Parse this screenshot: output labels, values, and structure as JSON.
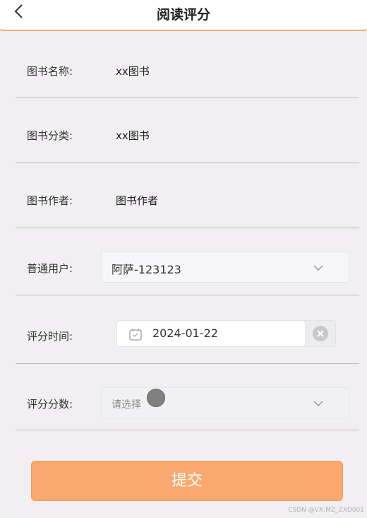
{
  "header": {
    "title": "阅读评分",
    "back_icon": "chevron-left-icon"
  },
  "form": {
    "book_name": {
      "label": "图书名称:",
      "value": "xx图书"
    },
    "book_category": {
      "label": "图书分类:",
      "value": "xx图书"
    },
    "book_author": {
      "label": "图书作者:",
      "value": "图书作者"
    },
    "user": {
      "label": "普通用户:",
      "value": "阿萨-123123",
      "icon": "chevron-down-icon"
    },
    "rating_time": {
      "label": "评分时间:",
      "value": "2024-01-22",
      "icon": "calendar-icon",
      "clear_icon": "clear-icon"
    },
    "rating_score": {
      "label": "评分分数:",
      "placeholder": "请选择",
      "icon": "chevron-down-icon"
    }
  },
  "submit_label": "提交",
  "watermark": "CSDN @VX:MZ_ZXD001",
  "colors": {
    "accent": "#f9a86f",
    "background": "#f1eff1",
    "header_border": "#f6a96a"
  }
}
